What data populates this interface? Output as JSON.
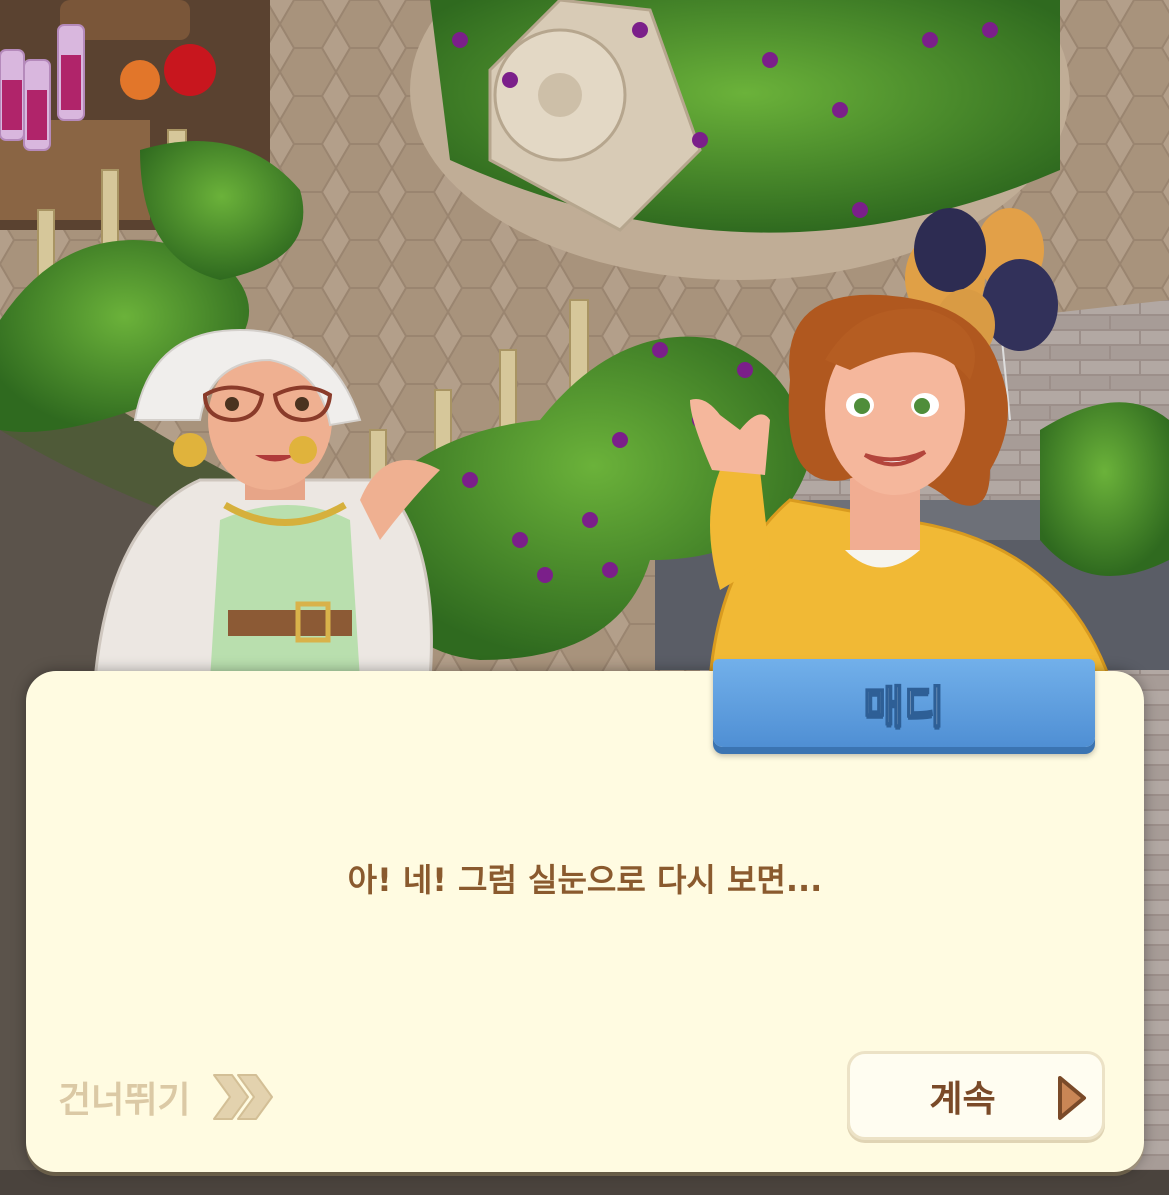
{
  "dialog": {
    "speaker_name": "매디",
    "text": "아! 네! 그럼 실눈으로 다시 보면...",
    "skip_label": "건너뛰기",
    "continue_label": "계속"
  },
  "characters": [
    {
      "role": "elderly-woman-with-glasses"
    },
    {
      "role": "madi"
    }
  ],
  "icons": {
    "skip": "double-chevron-right-icon",
    "continue": "triangle-right-icon"
  },
  "colors": {
    "panel": "#fffbe1",
    "name_tag": "#5d9ddf",
    "dialog_text": "#8a5a2e",
    "skip_text": "#dbc9a5",
    "continue_icon": "#c98655"
  }
}
